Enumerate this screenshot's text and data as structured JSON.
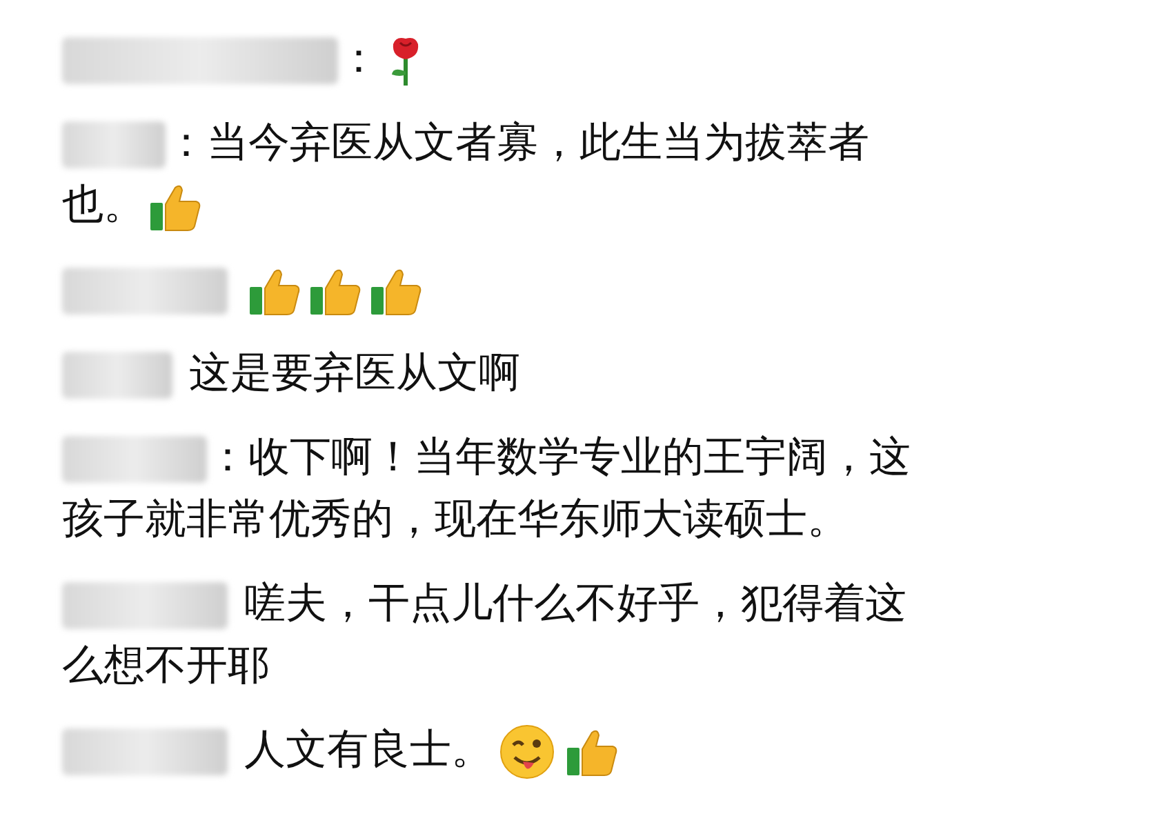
{
  "comments": [
    {
      "separator": "：",
      "emojis": [
        {
          "kind": "rose"
        }
      ]
    },
    {
      "separator": "：",
      "lines": [
        "当今弃医从文者寡，此生当为拔萃者",
        "也。"
      ],
      "emojis": [
        {
          "kind": "thumbs_up"
        }
      ]
    },
    {
      "emojis": [
        {
          "kind": "thumbs_up"
        },
        {
          "kind": "thumbs_up"
        },
        {
          "kind": "thumbs_up"
        }
      ]
    },
    {
      "lines": [
        "这是要弃医从文啊"
      ]
    },
    {
      "separator": "：",
      "lines": [
        "收下啊！当年数学专业的王宇阔，这",
        "孩子就非常优秀的，现在华东师大读硕士。"
      ]
    },
    {
      "lines": [
        "嗟夫，干点儿什么不好乎，犯得着这",
        "么想不开耶"
      ]
    },
    {
      "lines": [
        "人文有良士。"
      ],
      "emojis": [
        {
          "kind": "wink_tongue"
        },
        {
          "kind": "thumbs_up"
        }
      ]
    }
  ]
}
